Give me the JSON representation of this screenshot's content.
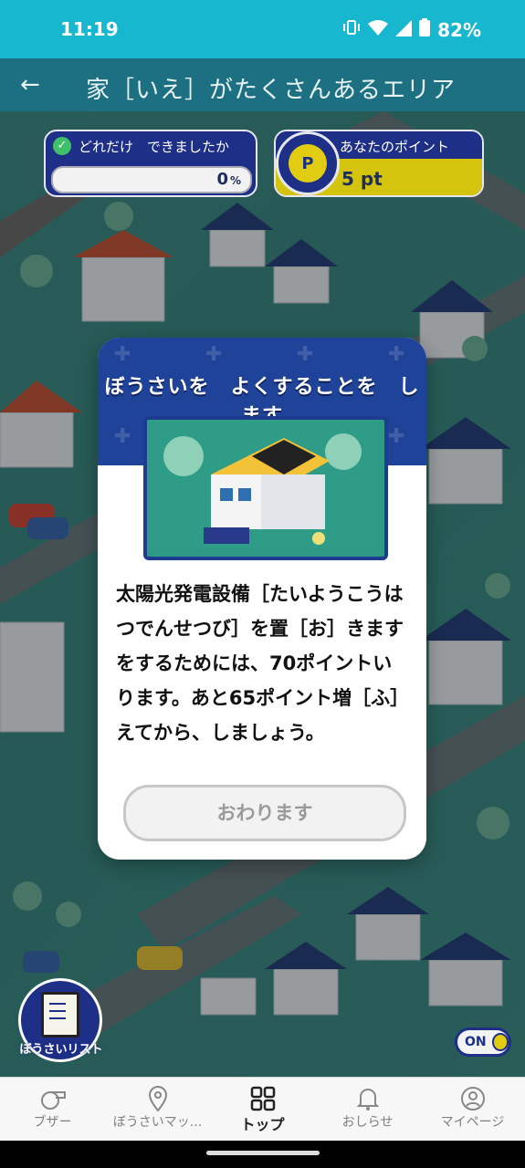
{
  "status_bar": {
    "time": "11:19",
    "battery": "82%"
  },
  "app_bar": {
    "title": "家［いえ］がたくさんあるエリア"
  },
  "progress": {
    "label": "どれだけ　できましたか",
    "value": "0",
    "unit": "%"
  },
  "points": {
    "label": "あなたのポイント",
    "value": "5 pt",
    "coin_letter": "P"
  },
  "modal": {
    "title": "ぼうさいを　よくすることを　します",
    "message": "太陽光発電設備［たいようこうはつでんせつび］を置［お］きますをするためには、70ポイントいります。あと65ポイント増［ふ］えてから、しましょう。",
    "close_button": "おわります"
  },
  "floating": {
    "checklist_label": "ぼうさいリスト",
    "toggle_label": "ON"
  },
  "bottom_nav": [
    {
      "label": "ブザー",
      "icon": "whistle-icon"
    },
    {
      "label": "ぼうさいマッ...",
      "icon": "map-pin-icon"
    },
    {
      "label": "トップ",
      "icon": "grid-icon"
    },
    {
      "label": "おしらせ",
      "icon": "bell-icon"
    },
    {
      "label": "マイページ",
      "icon": "person-icon"
    }
  ],
  "colors": {
    "status_bar": "#16b7cf",
    "navy": "#1d2f86",
    "yellow": "#d4c40e",
    "map_green": "#3f8e88"
  }
}
